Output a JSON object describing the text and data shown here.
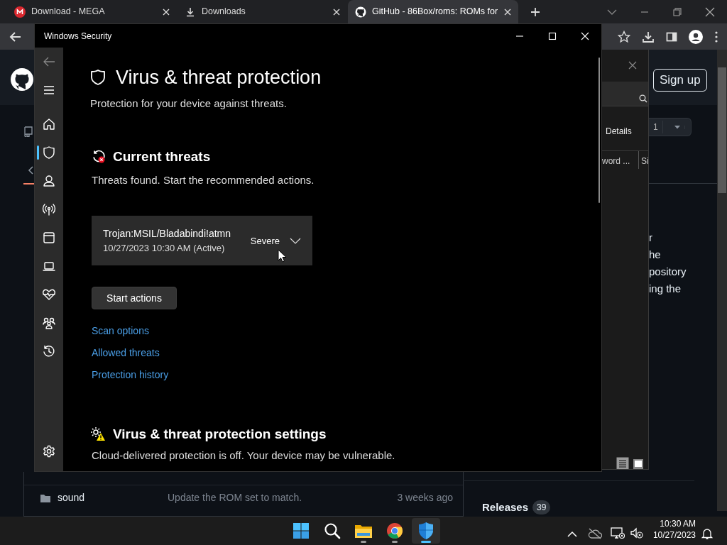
{
  "browser": {
    "tabs": [
      {
        "kind": "mega",
        "title": "Download - MEGA",
        "selected": false
      },
      {
        "kind": "download",
        "title": "Downloads",
        "selected": false
      },
      {
        "kind": "github",
        "title": "GitHub - 86Box/roms: ROMs for",
        "selected": true
      }
    ],
    "page": {
      "signup": "Sign up",
      "count": "1",
      "text_fragments": [
        "r",
        "he",
        "pository",
        "ing the"
      ],
      "files": [
        {
          "name": "sound",
          "message": "Update the ROM set to match.",
          "time": "3 weeks ago"
        }
      ],
      "releases": {
        "label": "Releases",
        "count": "39"
      }
    }
  },
  "explorer": {
    "details_label": "Details",
    "columns": [
      "word ...",
      "Si"
    ]
  },
  "security": {
    "title": "Windows Security",
    "nav": [
      {
        "kind": "home",
        "selected": false
      },
      {
        "kind": "shield",
        "selected": true
      },
      {
        "kind": "account",
        "selected": false
      },
      {
        "kind": "network",
        "selected": false
      },
      {
        "kind": "app",
        "selected": false
      },
      {
        "kind": "device",
        "selected": false
      },
      {
        "kind": "health",
        "selected": false
      },
      {
        "kind": "family",
        "selected": false
      },
      {
        "kind": "history",
        "selected": false
      }
    ],
    "heading": "Virus & threat protection",
    "subtitle": "Protection for your device against threats.",
    "threats": {
      "title": "Current threats",
      "text": "Threats found. Start the recommended actions.",
      "items": [
        {
          "name": "Trojan:MSIL/Bladabindi!atmn",
          "detail": "10/27/2023 10:30 AM (Active)",
          "severity": "Severe",
          "expanded": false
        }
      ],
      "action": "Start actions",
      "links": [
        "Scan options",
        "Allowed threats",
        "Protection history"
      ]
    },
    "settings": {
      "title": "Virus & threat protection settings",
      "text": "Cloud-delivered protection is off. Your device may be vulnerable."
    }
  },
  "taskbar": {
    "apps": [
      {
        "kind": "start",
        "running": false,
        "selected": false
      },
      {
        "kind": "search",
        "running": false,
        "selected": false
      },
      {
        "kind": "files",
        "running": true,
        "selected": false
      },
      {
        "kind": "chrome",
        "running": true,
        "selected": false
      },
      {
        "kind": "defender",
        "running": true,
        "selected": true
      }
    ],
    "time": "10:30 AM",
    "date": "10/27/2023"
  }
}
